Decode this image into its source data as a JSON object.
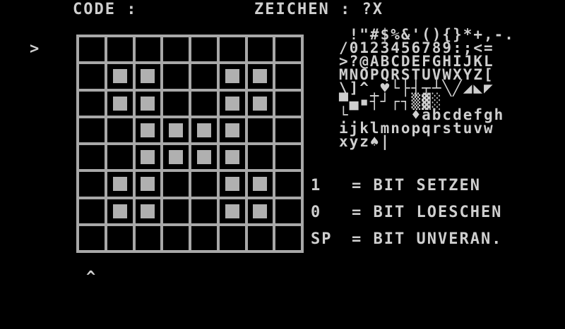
{
  "header": {
    "code_label": "CODE :",
    "zeichen_label": "ZEICHEN : ?X"
  },
  "cursor_row_marker": ">",
  "cursor_col_marker": "^",
  "grid": {
    "rows": 8,
    "cols": 8,
    "bits": [
      [
        0,
        0,
        0,
        0,
        0,
        0,
        0,
        0
      ],
      [
        0,
        1,
        1,
        0,
        0,
        1,
        1,
        0
      ],
      [
        0,
        1,
        1,
        0,
        0,
        1,
        1,
        0
      ],
      [
        0,
        0,
        1,
        1,
        1,
        1,
        0,
        0
      ],
      [
        0,
        0,
        1,
        1,
        1,
        1,
        0,
        0
      ],
      [
        0,
        1,
        1,
        0,
        0,
        1,
        1,
        0
      ],
      [
        0,
        1,
        1,
        0,
        0,
        1,
        1,
        0
      ],
      [
        0,
        0,
        0,
        0,
        0,
        0,
        0,
        0
      ]
    ]
  },
  "charset_rows": [
    " !\"#$%&'(){}*+,-.",
    "/0123456789:;<=",
    ">?@ABCDEFGHIJKL",
    "MNOPQRSTUVWXYZ[",
    "\\]^_♥└├┤┬┴╲╱◢◣◤",
    "▀▄▪┤┘┌┐▒▓░",
    "└      ♦abcdefgh",
    "ijklmnopqrstuvw",
    "xyz♠|"
  ],
  "legend": [
    {
      "key": "1 ",
      "text": "= BIT SETZEN"
    },
    {
      "key": "0 ",
      "text": "= BIT LOESCHEN"
    },
    {
      "key": "SP",
      "text": "= BIT UNVERAN."
    }
  ]
}
